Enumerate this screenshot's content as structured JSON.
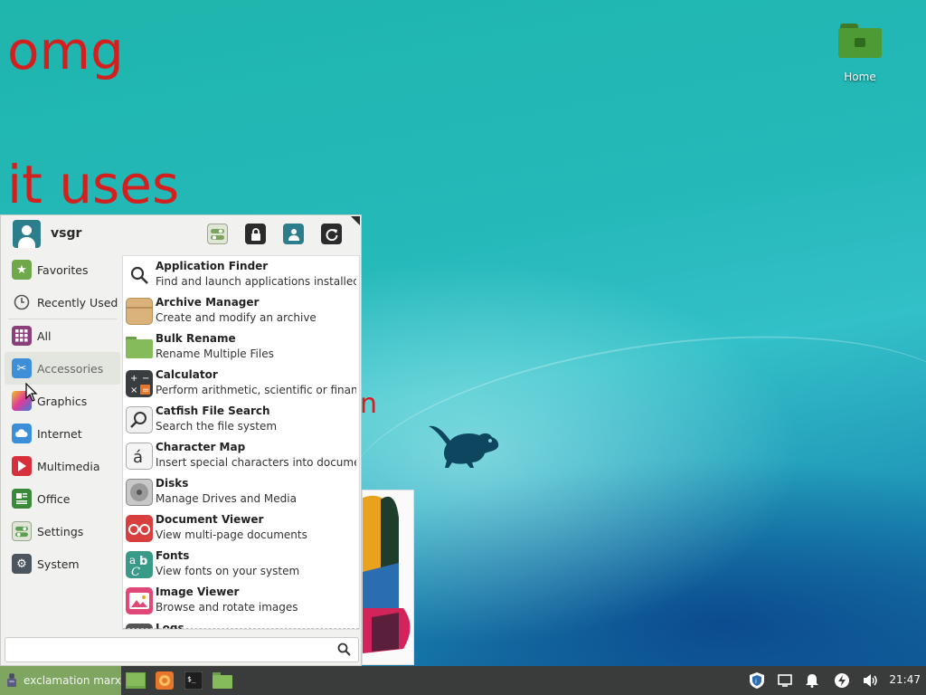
{
  "desktop": {
    "texts": [
      "omg",
      "it uses"
    ],
    "partial_text": "n",
    "home_icon_label": "Home"
  },
  "menu": {
    "username": "vsgr",
    "header_buttons": [
      "settings-icon",
      "lock-icon",
      "switch-user-icon",
      "logout-icon"
    ],
    "categories": [
      {
        "label": "Favorites",
        "icon": "favorites-folder-icon",
        "color": "#6fa84a"
      },
      {
        "label": "Recently Used",
        "icon": "clock-icon",
        "color": "#555555"
      },
      {
        "label": "All",
        "icon": "grid-icon",
        "color": "#8a3f7a"
      },
      {
        "label": "Accessories",
        "icon": "accessories-icon",
        "color": "#3f8fd8"
      },
      {
        "label": "Graphics",
        "icon": "graphics-icon",
        "color": "#e0399a"
      },
      {
        "label": "Internet",
        "icon": "cloud-icon",
        "color": "#3a8fd8"
      },
      {
        "label": "Multimedia",
        "icon": "play-icon",
        "color": "#d8303a"
      },
      {
        "label": "Office",
        "icon": "office-icon",
        "color": "#3a8a3a"
      },
      {
        "label": "Settings",
        "icon": "settings-toggle-icon",
        "color": "#5aa050"
      },
      {
        "label": "System",
        "icon": "gear-icon",
        "color": "#4a5560"
      }
    ],
    "active_category": "Accessories",
    "apps": [
      {
        "name": "Application Finder",
        "desc": "Find and launch applications installed ...",
        "icon": "search-icon"
      },
      {
        "name": "Archive Manager",
        "desc": "Create and modify an archive",
        "icon": "archive-icon"
      },
      {
        "name": "Bulk Rename",
        "desc": "Rename Multiple Files",
        "icon": "folder-icon"
      },
      {
        "name": "Calculator",
        "desc": "Perform arithmetic, scientific or finan...",
        "icon": "calculator-icon"
      },
      {
        "name": "Catfish File Search",
        "desc": "Search the file system",
        "icon": "magnifier-icon"
      },
      {
        "name": "Character Map",
        "desc": "Insert special characters into docume...",
        "icon": "character-map-icon"
      },
      {
        "name": "Disks",
        "desc": "Manage Drives and Media",
        "icon": "disk-icon"
      },
      {
        "name": "Document Viewer",
        "desc": "View multi-page documents",
        "icon": "document-viewer-icon"
      },
      {
        "name": "Fonts",
        "desc": "View fonts on your system",
        "icon": "fonts-icon"
      },
      {
        "name": "Image Viewer",
        "desc": "Browse and rotate images",
        "icon": "image-viewer-icon"
      },
      {
        "name": "Logs",
        "desc": "",
        "icon": "logs-icon"
      }
    ],
    "search_placeholder": ""
  },
  "taskbar": {
    "menu_label": "exclamation marx",
    "clock": "21:47"
  }
}
